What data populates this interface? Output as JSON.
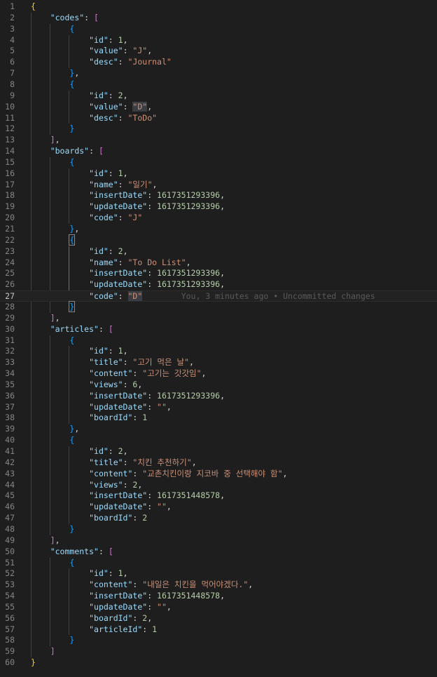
{
  "editor": {
    "language": "json",
    "blame_annotation": "You, 3 minutes ago • Uncommitted changes",
    "cursor_line": 27,
    "colors": {
      "background": "#1e1e1e",
      "key": "#9cdcfe",
      "string": "#ce9178",
      "number": "#b5cea8",
      "bracket_level1": "#ffd700",
      "bracket_level2": "#da70d6",
      "bracket_level3": "#179fff"
    },
    "lines": [
      [
        {
          "t": "{",
          "c": "b1"
        }
      ],
      [
        {
          "t": "    "
        },
        {
          "t": "\"codes\"",
          "c": "k"
        },
        {
          "t": ": "
        },
        {
          "t": "[",
          "c": "b2"
        }
      ],
      [
        {
          "t": "        "
        },
        {
          "t": "{",
          "c": "b3"
        }
      ],
      [
        {
          "t": "            "
        },
        {
          "t": "\"id\"",
          "c": "k"
        },
        {
          "t": ": "
        },
        {
          "t": "1",
          "c": "n"
        },
        {
          "t": ","
        }
      ],
      [
        {
          "t": "            "
        },
        {
          "t": "\"value\"",
          "c": "k"
        },
        {
          "t": ": "
        },
        {
          "t": "\"J\"",
          "c": "s"
        },
        {
          "t": ","
        }
      ],
      [
        {
          "t": "            "
        },
        {
          "t": "\"desc\"",
          "c": "k"
        },
        {
          "t": ": "
        },
        {
          "t": "\"Journal\"",
          "c": "s"
        }
      ],
      [
        {
          "t": "        "
        },
        {
          "t": "}",
          "c": "b3"
        },
        {
          "t": ","
        }
      ],
      [
        {
          "t": "        "
        },
        {
          "t": "{",
          "c": "b3"
        }
      ],
      [
        {
          "t": "            "
        },
        {
          "t": "\"id\"",
          "c": "k"
        },
        {
          "t": ": "
        },
        {
          "t": "2",
          "c": "n"
        },
        {
          "t": ","
        }
      ],
      [
        {
          "t": "            "
        },
        {
          "t": "\"value\"",
          "c": "k"
        },
        {
          "t": ": "
        },
        {
          "t": "\"D\"",
          "c": "s hl"
        },
        {
          "t": ","
        }
      ],
      [
        {
          "t": "            "
        },
        {
          "t": "\"desc\"",
          "c": "k"
        },
        {
          "t": ": "
        },
        {
          "t": "\"ToDo\"",
          "c": "s"
        }
      ],
      [
        {
          "t": "        "
        },
        {
          "t": "}",
          "c": "b3"
        }
      ],
      [
        {
          "t": "    "
        },
        {
          "t": "]",
          "c": "b2"
        },
        {
          "t": ","
        }
      ],
      [
        {
          "t": "    "
        },
        {
          "t": "\"boards\"",
          "c": "k"
        },
        {
          "t": ": "
        },
        {
          "t": "[",
          "c": "b2"
        }
      ],
      [
        {
          "t": "        "
        },
        {
          "t": "{",
          "c": "b3"
        }
      ],
      [
        {
          "t": "            "
        },
        {
          "t": "\"id\"",
          "c": "k"
        },
        {
          "t": ": "
        },
        {
          "t": "1",
          "c": "n"
        },
        {
          "t": ","
        }
      ],
      [
        {
          "t": "            "
        },
        {
          "t": "\"name\"",
          "c": "k"
        },
        {
          "t": ": "
        },
        {
          "t": "\"일기\"",
          "c": "s"
        },
        {
          "t": ","
        }
      ],
      [
        {
          "t": "            "
        },
        {
          "t": "\"insertDate\"",
          "c": "k"
        },
        {
          "t": ": "
        },
        {
          "t": "1617351293396",
          "c": "n"
        },
        {
          "t": ","
        }
      ],
      [
        {
          "t": "            "
        },
        {
          "t": "\"updateDate\"",
          "c": "k"
        },
        {
          "t": ": "
        },
        {
          "t": "1617351293396",
          "c": "n"
        },
        {
          "t": ","
        }
      ],
      [
        {
          "t": "            "
        },
        {
          "t": "\"code\"",
          "c": "k"
        },
        {
          "t": ": "
        },
        {
          "t": "\"J\"",
          "c": "s"
        }
      ],
      [
        {
          "t": "        "
        },
        {
          "t": "}",
          "c": "b3"
        },
        {
          "t": ","
        }
      ],
      [
        {
          "t": "        "
        },
        {
          "t": "{",
          "c": "b3 bm"
        }
      ],
      [
        {
          "t": "            "
        },
        {
          "t": "\"id\"",
          "c": "k"
        },
        {
          "t": ": "
        },
        {
          "t": "2",
          "c": "n"
        },
        {
          "t": ","
        }
      ],
      [
        {
          "t": "            "
        },
        {
          "t": "\"name\"",
          "c": "k"
        },
        {
          "t": ": "
        },
        {
          "t": "\"To Do List\"",
          "c": "s"
        },
        {
          "t": ","
        }
      ],
      [
        {
          "t": "            "
        },
        {
          "t": "\"insertDate\"",
          "c": "k"
        },
        {
          "t": ": "
        },
        {
          "t": "1617351293396",
          "c": "n"
        },
        {
          "t": ","
        }
      ],
      [
        {
          "t": "            "
        },
        {
          "t": "\"updateDate\"",
          "c": "k"
        },
        {
          "t": ": "
        },
        {
          "t": "1617351293396",
          "c": "n"
        },
        {
          "t": ","
        }
      ],
      [
        {
          "t": "            "
        },
        {
          "t": "\"code\"",
          "c": "k"
        },
        {
          "t": ": "
        },
        {
          "t": "\"D\"",
          "c": "s hl"
        },
        {
          "t": "        "
        },
        {
          "t": "You, 3 minutes ago • Uncommitted changes",
          "c": "blame"
        }
      ],
      [
        {
          "t": "        "
        },
        {
          "t": "}",
          "c": "b3 bm"
        }
      ],
      [
        {
          "t": "    "
        },
        {
          "t": "]",
          "c": "b2"
        },
        {
          "t": ","
        }
      ],
      [
        {
          "t": "    "
        },
        {
          "t": "\"articles\"",
          "c": "k"
        },
        {
          "t": ": "
        },
        {
          "t": "[",
          "c": "b2"
        }
      ],
      [
        {
          "t": "        "
        },
        {
          "t": "{",
          "c": "b3"
        }
      ],
      [
        {
          "t": "            "
        },
        {
          "t": "\"id\"",
          "c": "k"
        },
        {
          "t": ": "
        },
        {
          "t": "1",
          "c": "n"
        },
        {
          "t": ","
        }
      ],
      [
        {
          "t": "            "
        },
        {
          "t": "\"title\"",
          "c": "k"
        },
        {
          "t": ": "
        },
        {
          "t": "\"고기 먹은 날\"",
          "c": "s"
        },
        {
          "t": ","
        }
      ],
      [
        {
          "t": "            "
        },
        {
          "t": "\"content\"",
          "c": "k"
        },
        {
          "t": ": "
        },
        {
          "t": "\"고기는 갓갓임\"",
          "c": "s"
        },
        {
          "t": ","
        }
      ],
      [
        {
          "t": "            "
        },
        {
          "t": "\"views\"",
          "c": "k"
        },
        {
          "t": ": "
        },
        {
          "t": "6",
          "c": "n"
        },
        {
          "t": ","
        }
      ],
      [
        {
          "t": "            "
        },
        {
          "t": "\"insertDate\"",
          "c": "k"
        },
        {
          "t": ": "
        },
        {
          "t": "1617351293396",
          "c": "n"
        },
        {
          "t": ","
        }
      ],
      [
        {
          "t": "            "
        },
        {
          "t": "\"updateDate\"",
          "c": "k"
        },
        {
          "t": ": "
        },
        {
          "t": "\"\"",
          "c": "s"
        },
        {
          "t": ","
        }
      ],
      [
        {
          "t": "            "
        },
        {
          "t": "\"boardId\"",
          "c": "k"
        },
        {
          "t": ": "
        },
        {
          "t": "1",
          "c": "n"
        }
      ],
      [
        {
          "t": "        "
        },
        {
          "t": "}",
          "c": "b3"
        },
        {
          "t": ","
        }
      ],
      [
        {
          "t": "        "
        },
        {
          "t": "{",
          "c": "b3"
        }
      ],
      [
        {
          "t": "            "
        },
        {
          "t": "\"id\"",
          "c": "k"
        },
        {
          "t": ": "
        },
        {
          "t": "2",
          "c": "n"
        },
        {
          "t": ","
        }
      ],
      [
        {
          "t": "            "
        },
        {
          "t": "\"title\"",
          "c": "k"
        },
        {
          "t": ": "
        },
        {
          "t": "\"치킨 추천하기\"",
          "c": "s"
        },
        {
          "t": ","
        }
      ],
      [
        {
          "t": "            "
        },
        {
          "t": "\"content\"",
          "c": "k"
        },
        {
          "t": ": "
        },
        {
          "t": "\"교촌치킨이랑 지코바 중 선택해야 함\"",
          "c": "s"
        },
        {
          "t": ","
        }
      ],
      [
        {
          "t": "            "
        },
        {
          "t": "\"views\"",
          "c": "k"
        },
        {
          "t": ": "
        },
        {
          "t": "2",
          "c": "n"
        },
        {
          "t": ","
        }
      ],
      [
        {
          "t": "            "
        },
        {
          "t": "\"insertDate\"",
          "c": "k"
        },
        {
          "t": ": "
        },
        {
          "t": "1617351448578",
          "c": "n"
        },
        {
          "t": ","
        }
      ],
      [
        {
          "t": "            "
        },
        {
          "t": "\"updateDate\"",
          "c": "k"
        },
        {
          "t": ": "
        },
        {
          "t": "\"\"",
          "c": "s"
        },
        {
          "t": ","
        }
      ],
      [
        {
          "t": "            "
        },
        {
          "t": "\"boardId\"",
          "c": "k"
        },
        {
          "t": ": "
        },
        {
          "t": "2",
          "c": "n"
        }
      ],
      [
        {
          "t": "        "
        },
        {
          "t": "}",
          "c": "b3"
        }
      ],
      [
        {
          "t": "    "
        },
        {
          "t": "]",
          "c": "b2"
        },
        {
          "t": ","
        }
      ],
      [
        {
          "t": "    "
        },
        {
          "t": "\"comments\"",
          "c": "k"
        },
        {
          "t": ": "
        },
        {
          "t": "[",
          "c": "b2"
        }
      ],
      [
        {
          "t": "        "
        },
        {
          "t": "{",
          "c": "b3"
        }
      ],
      [
        {
          "t": "            "
        },
        {
          "t": "\"id\"",
          "c": "k"
        },
        {
          "t": ": "
        },
        {
          "t": "1",
          "c": "n"
        },
        {
          "t": ","
        }
      ],
      [
        {
          "t": "            "
        },
        {
          "t": "\"content\"",
          "c": "k"
        },
        {
          "t": ": "
        },
        {
          "t": "\"내일은 치킨을 먹어야겠다.\"",
          "c": "s"
        },
        {
          "t": ","
        }
      ],
      [
        {
          "t": "            "
        },
        {
          "t": "\"insertDate\"",
          "c": "k"
        },
        {
          "t": ": "
        },
        {
          "t": "1617351448578",
          "c": "n"
        },
        {
          "t": ","
        }
      ],
      [
        {
          "t": "            "
        },
        {
          "t": "\"updateDate\"",
          "c": "k"
        },
        {
          "t": ": "
        },
        {
          "t": "\"\"",
          "c": "s"
        },
        {
          "t": ","
        }
      ],
      [
        {
          "t": "            "
        },
        {
          "t": "\"boardId\"",
          "c": "k"
        },
        {
          "t": ": "
        },
        {
          "t": "2",
          "c": "n"
        },
        {
          "t": ","
        }
      ],
      [
        {
          "t": "            "
        },
        {
          "t": "\"articleId\"",
          "c": "k"
        },
        {
          "t": ": "
        },
        {
          "t": "1",
          "c": "n"
        }
      ],
      [
        {
          "t": "        "
        },
        {
          "t": "}",
          "c": "b3"
        }
      ],
      [
        {
          "t": "    "
        },
        {
          "t": "]",
          "c": "b2"
        }
      ],
      [
        {
          "t": "}",
          "c": "b1"
        }
      ]
    ]
  }
}
